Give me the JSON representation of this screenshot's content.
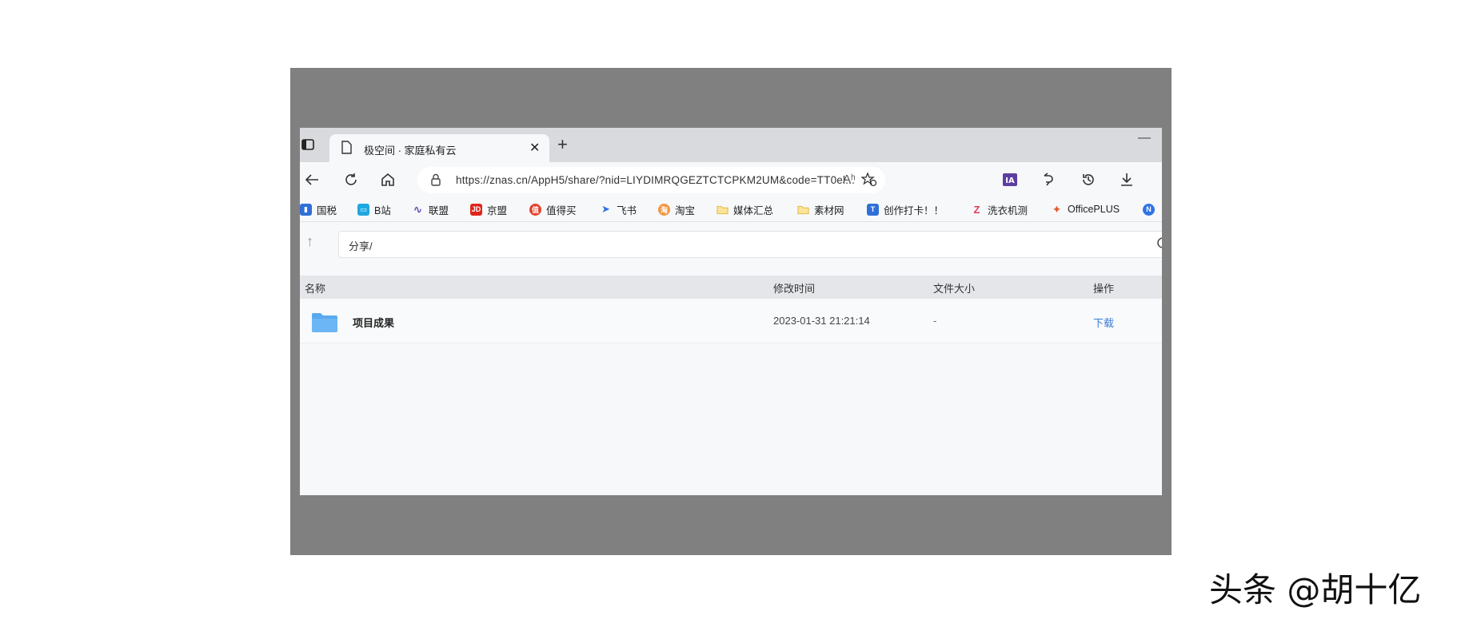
{
  "browser": {
    "tab": {
      "title": "极空间 · 家庭私有云",
      "close_label": "✕"
    },
    "new_tab_label": "+",
    "minimize_label": "—",
    "address": {
      "url": "https://znas.cn/AppH5/share/?nid=LIYDIMRQGEZTCTCPKM2UM&code=TT0el...",
      "read_aloud_label": "Aʰ"
    },
    "bookmarks": [
      {
        "label": "国税",
        "icon": "tax-icon",
        "color": "#2f6fd6"
      },
      {
        "label": "B站",
        "icon": "bilibili-icon",
        "color": "#20a7e0"
      },
      {
        "label": "联盟",
        "icon": "wave-icon",
        "color": "#6a4fb8"
      },
      {
        "label": "京盟",
        "icon": "jd-icon",
        "color": "#e1251b",
        "glyph": "JD"
      },
      {
        "label": "值得买",
        "icon": "smzdm-icon",
        "color": "#e5412d"
      },
      {
        "label": "飞书",
        "icon": "feishu-icon",
        "color": "#2f74e6"
      },
      {
        "label": "淘宝",
        "icon": "taobao-icon",
        "color": "#f29640"
      },
      {
        "label": "媒体汇总",
        "icon": "folder-icon",
        "color": "#f3c343"
      },
      {
        "label": "素材网",
        "icon": "folder-icon",
        "color": "#f3c343"
      },
      {
        "label": "创作打卡！！",
        "icon": "checkin-icon",
        "color": "#2f6fd6",
        "glyph": "T"
      },
      {
        "label": "洗衣机测",
        "icon": "z-icon",
        "color": "#e33a56",
        "glyph": "Z"
      },
      {
        "label": "OfficePLUS",
        "icon": "officeplus-icon",
        "color": "#e65c2f"
      },
      {
        "label": "",
        "icon": "n-icon",
        "color": "#2f74e6",
        "glyph": "N"
      }
    ]
  },
  "file_browser": {
    "path": "分享/",
    "columns": {
      "name": "名称",
      "modified": "修改时间",
      "size": "文件大小",
      "actions": "操作"
    },
    "rows": [
      {
        "name": "项目成果",
        "modified": "2023-01-31 21:21:14",
        "size": "-",
        "action": "下载"
      }
    ]
  },
  "watermark": "头条 @胡十亿",
  "colors": {
    "frame": "#808080",
    "link": "#3a7bd5",
    "folder": "#5aa9f0"
  }
}
